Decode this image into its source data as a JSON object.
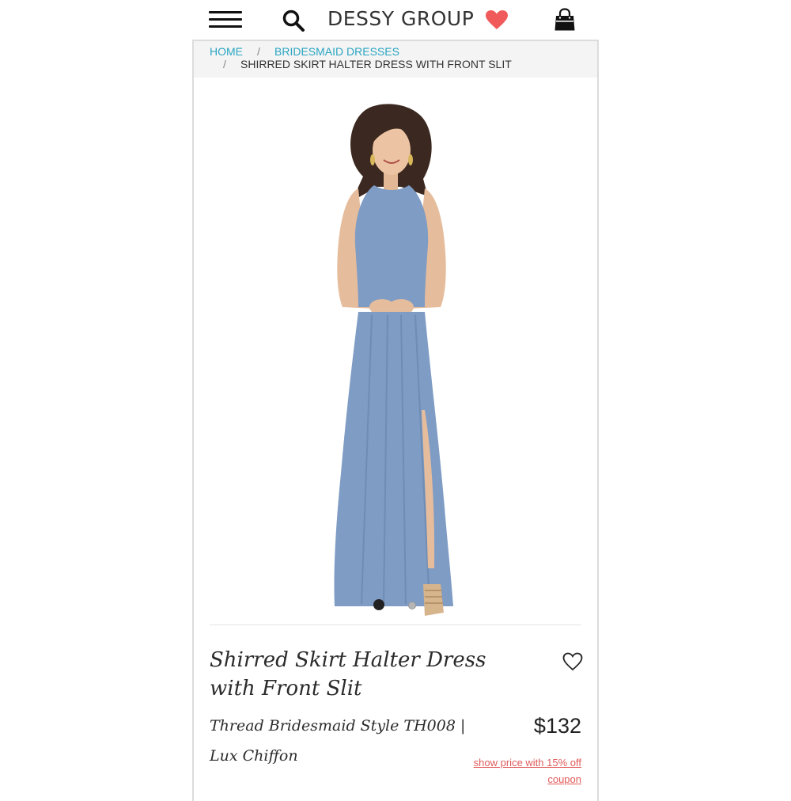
{
  "header": {
    "brand": "DESSY GROUP",
    "icons": [
      "menu-icon",
      "search-icon",
      "heart-icon",
      "shopping-bag-icon"
    ],
    "heart_color": "#f05a5a"
  },
  "breadcrumb": {
    "home": "HOME",
    "sep": "/",
    "category": "BRIDESMAID DRESSES",
    "current": "SHIRRED SKIRT HALTER DRESS WITH FRONT SLIT",
    "link_color": "#2aa5c2"
  },
  "gallery": {
    "dress_color": "#7f9cc4",
    "slides": 2,
    "active_slide": 1
  },
  "product": {
    "title": "Shirred Skirt Halter Dress with Front Slit",
    "style_line": "Thread Bridesmaid Style TH008  |",
    "fabric": "Lux Chiffon",
    "price": "$132",
    "coupon": "show price with 15% off coupon",
    "coupon_color": "#e05a5a"
  }
}
